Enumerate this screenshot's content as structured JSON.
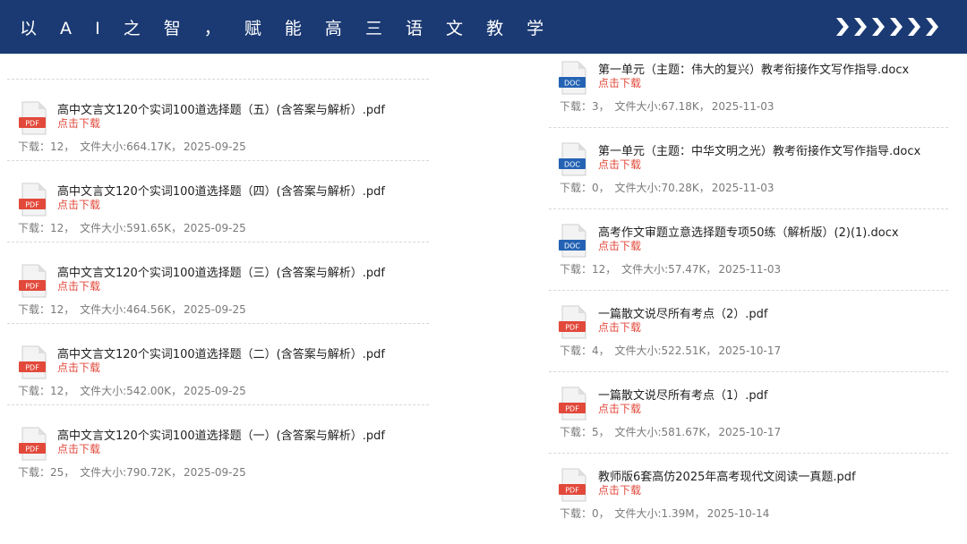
{
  "header": {
    "title": "以 A I 之 智 ， 赋 能 高 三 语 文 教 学",
    "bg_color": "#1b3a73",
    "decoration_icon": "chevron-right-icon"
  },
  "labels": {
    "download_link": "点击下载",
    "downloads_prefix": "下载：",
    "size_prefix": "文件大小:"
  },
  "left_files": [
    {
      "title": "高中文言文120个实词100道选择题（五）(含答案与解析）.pdf",
      "type": "PDF",
      "downloads": "12",
      "size": "664.17K",
      "date": "2025-09-25"
    },
    {
      "title": "高中文言文120个实词100道选择题（四）(含答案与解析）.pdf",
      "type": "PDF",
      "downloads": "12",
      "size": "591.65K",
      "date": "2025-09-25"
    },
    {
      "title": "高中文言文120个实词100道选择题（三）(含答案与解析）.pdf",
      "type": "PDF",
      "downloads": "12",
      "size": "464.56K",
      "date": "2025-09-25"
    },
    {
      "title": "高中文言文120个实词100道选择题（二）(含答案与解析）.pdf",
      "type": "PDF",
      "downloads": "12",
      "size": "542.00K",
      "date": "2025-09-25"
    },
    {
      "title": "高中文言文120个实词100道选择题（一）(含答案与解析）.pdf",
      "type": "PDF",
      "downloads": "25",
      "size": "790.72K",
      "date": "2025-09-25"
    }
  ],
  "right_files": [
    {
      "title": "第一单元（主题：伟大的复兴）教考衔接作文写作指导.docx",
      "type": "DOC",
      "downloads": "3",
      "size": "67.18K",
      "date": "2025-11-03"
    },
    {
      "title": "第一单元（主题：中华文明之光）教考衔接作文写作指导.docx",
      "type": "DOC",
      "downloads": "0",
      "size": "70.28K",
      "date": "2025-11-03"
    },
    {
      "title": "高考作文审题立意选择题专项50练（解析版）(2)(1).docx",
      "type": "DOC",
      "downloads": "12",
      "size": "57.47K",
      "date": "2025-11-03"
    },
    {
      "title": "一篇散文说尽所有考点（2）.pdf",
      "type": "PDF",
      "downloads": "4",
      "size": "522.51K",
      "date": "2025-10-17"
    },
    {
      "title": "一篇散文说尽所有考点（1）.pdf",
      "type": "PDF",
      "downloads": "5",
      "size": "581.67K",
      "date": "2025-10-17"
    },
    {
      "title": "教师版6套高仿2025年高考现代文阅读一真题.pdf",
      "type": "PDF",
      "downloads": "0",
      "size": "1.39M",
      "date": "2025-10-14"
    }
  ],
  "colors": {
    "link": "#e2493b",
    "pdf_badge": "#e2493b",
    "doc_badge": "#2463b4",
    "meta_text": "#7a7a7a"
  }
}
